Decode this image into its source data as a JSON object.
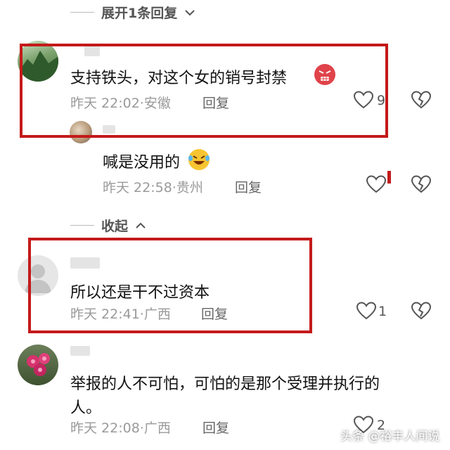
{
  "expand_replies": "展开1条回复",
  "collapse": "收起",
  "comments": [
    {
      "text": "支持铁头，对这个女的销号封禁",
      "time": "昨天 22:02",
      "location": "安徽",
      "reply": "回复",
      "likes": "9"
    },
    {
      "text": "喊是没用的",
      "time": "昨天 22:58",
      "location": "贵州",
      "reply": "回复",
      "likes": ""
    },
    {
      "text": "所以还是干不过资本",
      "time": "昨天 22:41",
      "location": "广西",
      "reply": "回复",
      "likes": "1"
    },
    {
      "text_line1": "举报的人不可怕，可怕的是那个受理并执行的",
      "text_line2": "人。",
      "time": "昨天 22:08",
      "location": "广西",
      "reply": "回复",
      "likes": "2"
    }
  ],
  "watermark": "头条 @裕丰人间说",
  "colors": {
    "highlight_box": "#c41a1a",
    "text": "#111111",
    "meta": "#9a9a9a"
  }
}
